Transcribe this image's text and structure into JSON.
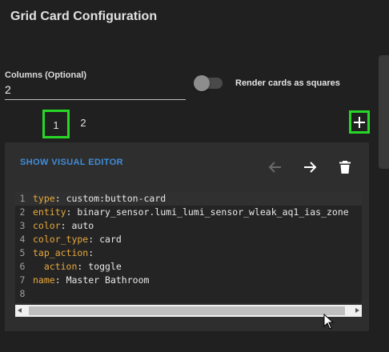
{
  "header": {
    "title": "Grid Card Configuration"
  },
  "columns": {
    "label": "Columns (Optional)",
    "value": "2"
  },
  "square_toggle": {
    "label": "Render cards as squares",
    "checked": false
  },
  "tabs": [
    {
      "label": "1",
      "selected": true
    },
    {
      "label": "2",
      "selected": false
    }
  ],
  "add_button": {
    "icon": "plus-icon"
  },
  "editor": {
    "show_visual_label": "SHOW VISUAL EDITOR",
    "icons": {
      "back": "arrow-left-icon",
      "forward": "arrow-right-icon",
      "delete": "trash-icon"
    },
    "lines": [
      {
        "num": "1",
        "key": "type",
        "sep": ": ",
        "val": "custom:button-card",
        "indent": ""
      },
      {
        "num": "2",
        "key": "entity",
        "sep": ": ",
        "val": "binary_sensor.lumi_lumi_sensor_wleak_aq1_ias_zone",
        "indent": ""
      },
      {
        "num": "3",
        "key": "color",
        "sep": ": ",
        "val": "auto",
        "indent": ""
      },
      {
        "num": "4",
        "key": "color_type",
        "sep": ": ",
        "val": "card",
        "indent": ""
      },
      {
        "num": "5",
        "key": "tap_action",
        "sep": ":",
        "val": "",
        "indent": ""
      },
      {
        "num": "6",
        "key": "action",
        "sep": ": ",
        "val": "toggle",
        "indent": "  "
      },
      {
        "num": "7",
        "key": "name",
        "sep": ": ",
        "val": "Master Bathroom",
        "indent": ""
      },
      {
        "num": "8",
        "key": "",
        "sep": "",
        "val": "",
        "indent": ""
      }
    ]
  },
  "colors": {
    "accent": "#3f8ddb",
    "highlight_box": "#27d627",
    "yaml_key": "#e8a93b"
  }
}
